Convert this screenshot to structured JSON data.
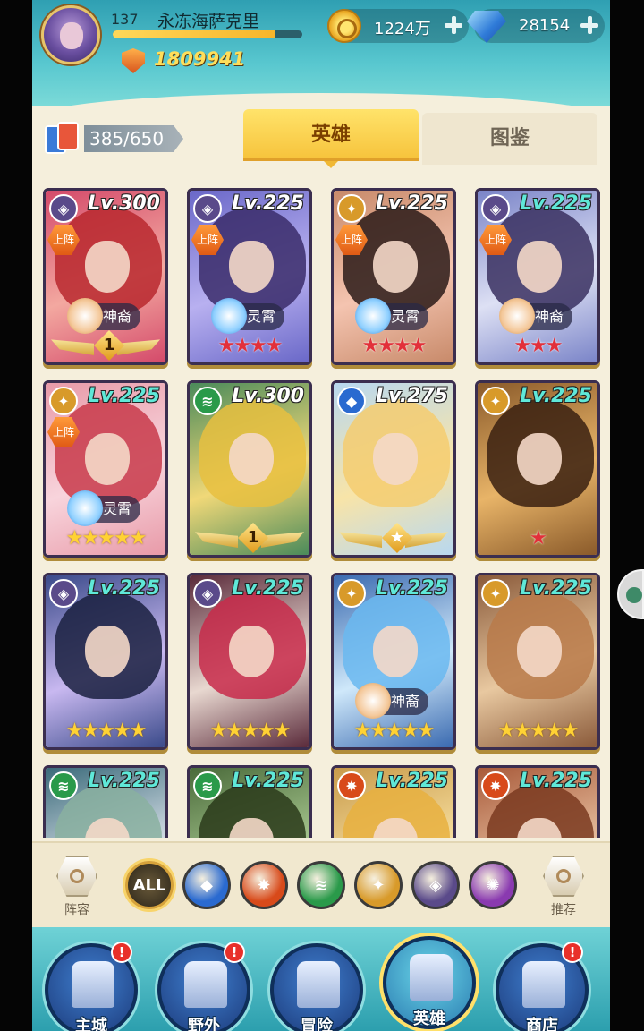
{
  "player": {
    "level": "137",
    "name": "永冻海萨克里",
    "exp_fraction": 0.86,
    "power": "1809941"
  },
  "resources": {
    "gold": "1224万",
    "gems": "28154"
  },
  "hero_count": "385/650",
  "tabs": {
    "heroes": "英雄",
    "codex": "图鉴"
  },
  "cards": [
    {
      "level": "Lv.300",
      "level_color": "white",
      "faction": "void",
      "deployed": "上阵",
      "tag": "神裔",
      "stars": 0,
      "star_color": "",
      "medal": "1",
      "palette": [
        "#d44a6a",
        "#f3a8a0",
        "#b8282e"
      ]
    },
    {
      "level": "Lv.225",
      "level_color": "white",
      "faction": "void",
      "deployed": "上阵",
      "tag": "灵霄",
      "stars": 4,
      "star_color": "red",
      "medal": "",
      "palette": [
        "#6a68c8",
        "#b8b0f0",
        "#3a2c6a"
      ]
    },
    {
      "level": "Lv.225",
      "level_color": "white",
      "faction": "light",
      "deployed": "上阵",
      "tag": "灵霄",
      "stars": 4,
      "star_color": "red",
      "medal": "",
      "palette": [
        "#c88a6a",
        "#f4c4b0",
        "#2a1a18"
      ]
    },
    {
      "level": "Lv.225",
      "level_color": "teal",
      "faction": "void",
      "deployed": "上阵",
      "tag": "神裔",
      "stars": 3,
      "star_color": "red",
      "medal": "",
      "palette": [
        "#7a84c8",
        "#dde0f4",
        "#3a3060"
      ]
    },
    {
      "level": "Lv.225",
      "level_color": "teal",
      "faction": "light",
      "deployed": "上阵",
      "tag": "灵霄",
      "stars": 5,
      "star_color": "gold",
      "medal": "",
      "palette": [
        "#e89aa8",
        "#f8d4dc",
        "#c83a4a"
      ]
    },
    {
      "level": "Lv.300",
      "level_color": "white",
      "faction": "nature",
      "deployed": "",
      "tag": "",
      "stars": 0,
      "star_color": "",
      "medal": "1",
      "palette": [
        "#4a8a5a",
        "#f0d878",
        "#e8c040"
      ]
    },
    {
      "level": "Lv.275",
      "level_color": "white",
      "faction": "water",
      "deployed": "",
      "tag": "",
      "stars": 0,
      "star_color": "",
      "medal": "★",
      "palette": [
        "#b8d8f0",
        "#f8e4a8",
        "#f4cc70"
      ]
    },
    {
      "level": "Lv.225",
      "level_color": "teal",
      "faction": "light",
      "deployed": "",
      "tag": "",
      "stars": 1,
      "star_color": "red",
      "medal": "",
      "palette": [
        "#8a5a2a",
        "#e8b468",
        "#3a2010"
      ]
    },
    {
      "level": "Lv.225",
      "level_color": "teal",
      "faction": "void",
      "deployed": "",
      "tag": "",
      "stars": 5,
      "star_color": "gold",
      "medal": "",
      "palette": [
        "#3a4a8a",
        "#c8b8f0",
        "#1a2040"
      ]
    },
    {
      "level": "Lv.225",
      "level_color": "teal",
      "faction": "void",
      "deployed": "",
      "tag": "",
      "stars": 5,
      "star_color": "gold",
      "medal": "",
      "palette": [
        "#5a2a3a",
        "#e8d8d0",
        "#c82a4a"
      ]
    },
    {
      "level": "Lv.225",
      "level_color": "teal",
      "faction": "light",
      "deployed": "",
      "tag": "神裔",
      "stars": 5,
      "star_color": "gold",
      "medal": "",
      "palette": [
        "#3a6ab0",
        "#cfe8fa",
        "#6ab8f0"
      ]
    },
    {
      "level": "Lv.225",
      "level_color": "teal",
      "faction": "light",
      "deployed": "",
      "tag": "",
      "stars": 5,
      "star_color": "gold",
      "medal": "",
      "palette": [
        "#8a5a3a",
        "#e8c8a0",
        "#b87a4a"
      ]
    },
    {
      "level": "Lv.225",
      "level_color": "teal",
      "faction": "nature",
      "deployed": "",
      "tag": "",
      "stars": 0,
      "star_color": "",
      "medal": "",
      "palette": [
        "#3a6a7a",
        "#d8e0e8",
        "#8ab0a0"
      ]
    },
    {
      "level": "Lv.225",
      "level_color": "teal",
      "faction": "nature",
      "deployed": "",
      "tag": "",
      "stars": 0,
      "star_color": "",
      "medal": "",
      "palette": [
        "#4a6a3a",
        "#a8c890",
        "#2a3a1a"
      ]
    },
    {
      "level": "Lv.225",
      "level_color": "teal",
      "faction": "fire",
      "deployed": "",
      "tag": "",
      "stars": 0,
      "star_color": "",
      "medal": "",
      "palette": [
        "#c89a4a",
        "#f8e0a0",
        "#e8b040"
      ]
    },
    {
      "level": "Lv.225",
      "level_color": "teal",
      "faction": "fire",
      "deployed": "",
      "tag": "",
      "stars": 0,
      "star_color": "",
      "medal": "",
      "palette": [
        "#a85a3a",
        "#e8c0a0",
        "#7a3a20"
      ]
    }
  ],
  "faction_colors": {
    "void": "#5a4a8a",
    "light": "#d89a2a",
    "nature": "#2a9a4a",
    "water": "#2a6ad0",
    "fire": "#d84a1a",
    "chaos": "#8a3ab0"
  },
  "filters": {
    "lineup_label": "阵容",
    "recommend_label": "推荐",
    "all_label": "ALL",
    "factions": [
      "water",
      "fire",
      "nature",
      "light",
      "void",
      "chaos"
    ]
  },
  "nav": [
    {
      "label": "主城",
      "alert": "!"
    },
    {
      "label": "野外",
      "alert": "!"
    },
    {
      "label": "冒险",
      "alert": ""
    },
    {
      "label": "英雄",
      "alert": ""
    },
    {
      "label": "商店",
      "alert": "!"
    }
  ]
}
